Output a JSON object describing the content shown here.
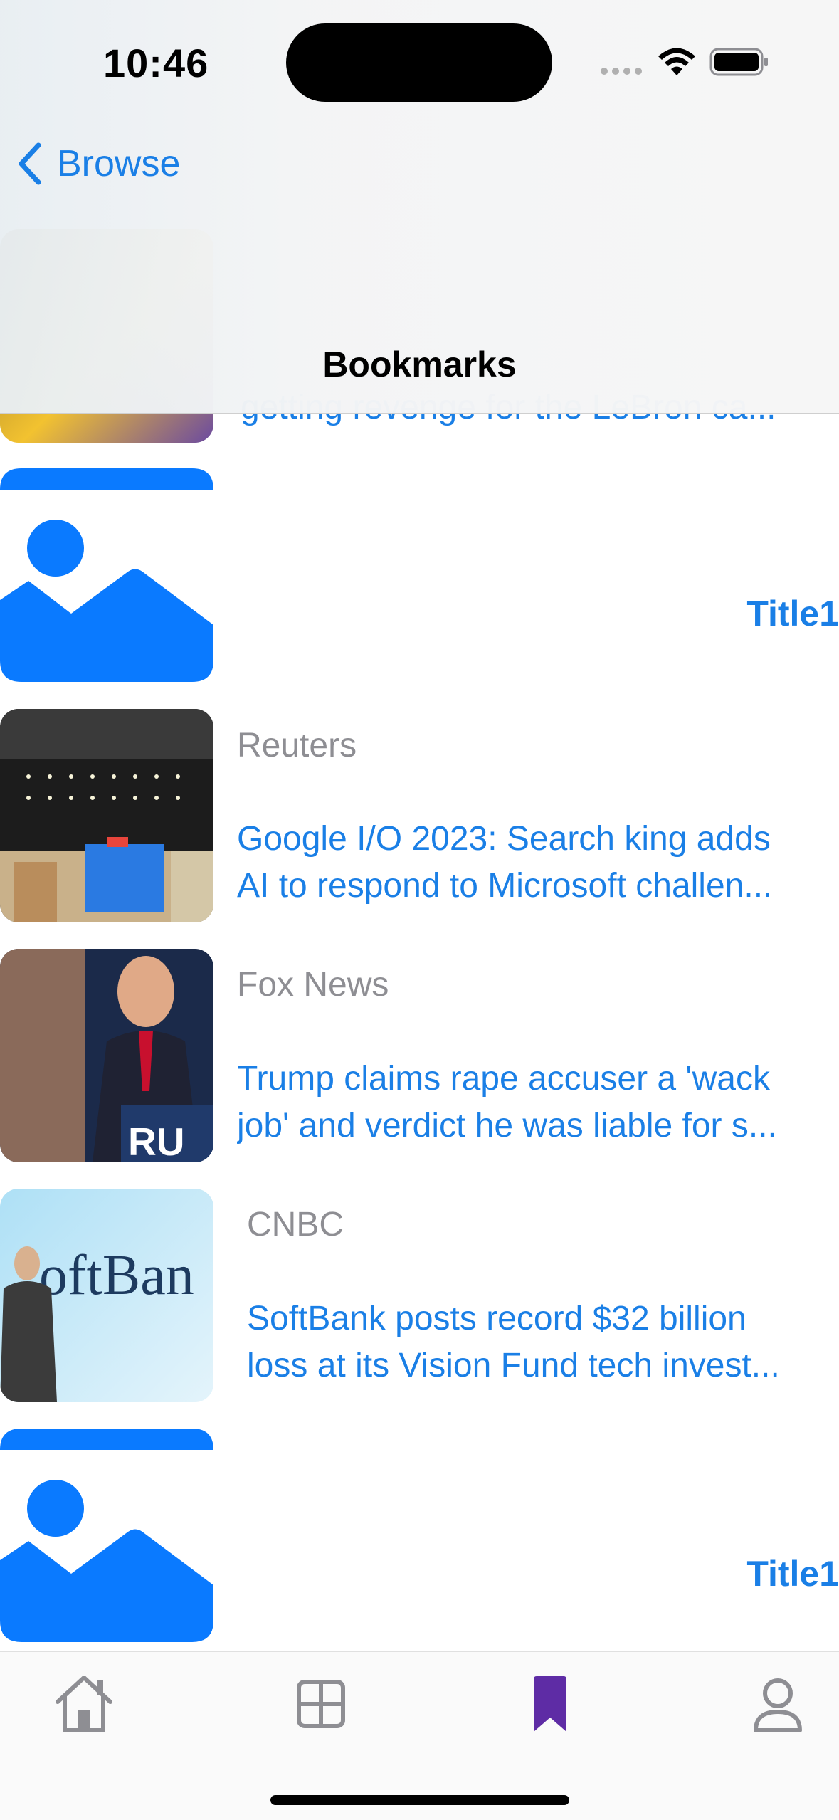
{
  "status_bar": {
    "time": "10:46"
  },
  "nav": {
    "back_label": "Browse",
    "title": "Bookmarks"
  },
  "articles": [
    {
      "source": "",
      "headline_line1": "getting revenge for the LeBron ca...",
      "headline_line2": "",
      "image": "lakers-photo"
    },
    {
      "placeholder_title": "Title1",
      "image": "photo-placeholder-icon"
    },
    {
      "source": "Reuters",
      "headline_line1": "Google I/O 2023: Search king adds",
      "headline_line2": "AI to respond to Microsoft challen...",
      "image": "google-io-stage-photo"
    },
    {
      "source": "Fox News",
      "headline_line1": "Trump claims rape accuser a 'wack",
      "headline_line2": "job' and verdict he was liable for s...",
      "image": "trump-rally-photo"
    },
    {
      "source": "CNBC",
      "headline_line1": "SoftBank posts record $32 billion",
      "headline_line2": "loss at its Vision Fund tech invest...",
      "image": "softbank-photo"
    },
    {
      "placeholder_title": "Title1",
      "image": "photo-placeholder-icon"
    }
  ],
  "tabs": [
    {
      "name": "home",
      "icon": "house-icon",
      "selected": false
    },
    {
      "name": "browse",
      "icon": "grid-icon",
      "selected": false
    },
    {
      "name": "bookmarks",
      "icon": "bookmark-icon",
      "selected": true
    },
    {
      "name": "profile",
      "icon": "person-icon",
      "selected": false
    }
  ],
  "colors": {
    "accent": "#1a7fe6",
    "placeholder_blue": "#0a7aff",
    "selected_tab": "#5e2ca5",
    "unselected_tab": "#8e8e93",
    "source_gray": "#8e8e93"
  }
}
